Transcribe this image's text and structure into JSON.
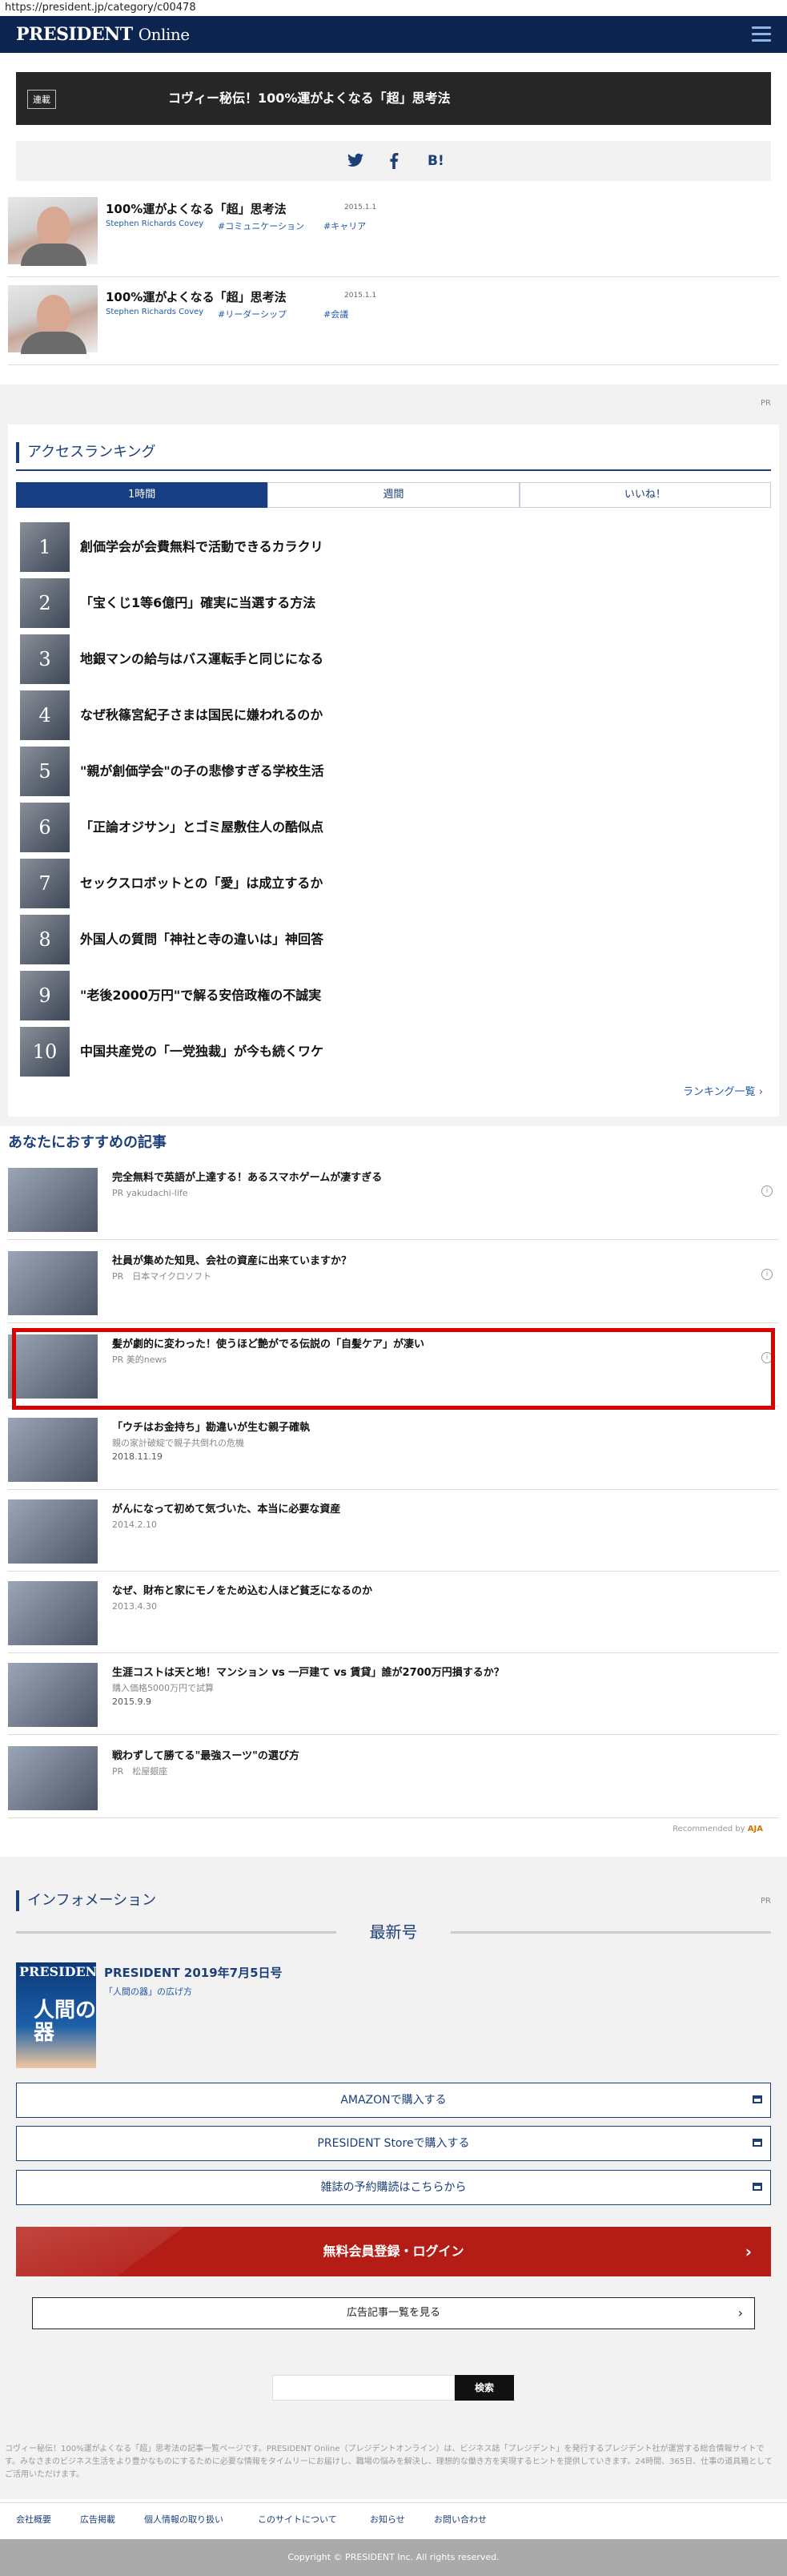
{
  "browser": {
    "url": "https://president.jp/category/c00478"
  },
  "header": {
    "logo_main": "PRESIDENT",
    "logo_sub": "Online",
    "menu_icon": "hamburger-menu-icon"
  },
  "banner": {
    "tag": "連載",
    "title": "コヴィー秘伝！100%運がよくなる「超」思考法"
  },
  "share": {
    "twitter": "twitter-icon",
    "facebook": "facebook-icon",
    "hatena": "B!"
  },
  "authors": [
    {
      "title": "100%運がよくなる「超」思考法",
      "date": "2015.1.1",
      "author": "Stephen Richards Covey",
      "tags": [
        "#コミュニケーション",
        "#キャリア"
      ]
    },
    {
      "title": "100%運がよくなる「超」思考法",
      "date": "2015.1.1",
      "author": "Stephen Richards Covey",
      "tags": [
        "#リーダーシップ",
        "#会議"
      ]
    }
  ],
  "pr_label": "PR",
  "ranking": {
    "heading": "アクセスランキング",
    "tabs": [
      "1時間",
      "週間",
      "いいね！"
    ],
    "active_tab": "1時間",
    "items": [
      {
        "rank": "1",
        "title": "創価学会が会費無料で活動できるカラクリ"
      },
      {
        "rank": "2",
        "title": "「宝くじ1等6億円」確実に当選する方法"
      },
      {
        "rank": "3",
        "title": "地銀マンの給与はバス運転手と同じになる"
      },
      {
        "rank": "4",
        "title": "なぜ秋篠宮紀子さまは国民に嫌われるのか"
      },
      {
        "rank": "5",
        "title": "\"親が創価学会\"の子の悲惨すぎる学校生活"
      },
      {
        "rank": "6",
        "title": "「正論オジサン」とゴミ屋敷住人の酷似点"
      },
      {
        "rank": "7",
        "title": "セックスロボットとの「愛」は成立するか"
      },
      {
        "rank": "8",
        "title": "外国人の質問「神社と寺の違いは」神回答"
      },
      {
        "rank": "9",
        "title": "\"老後2000万円\"で解る安倍政権の不誠実"
      },
      {
        "rank": "10",
        "title": "中国共産党の「一党独裁」が今も続くワケ"
      }
    ],
    "more": "ランキング一覧"
  },
  "recommend": {
    "heading": "あなたにおすすめの記事",
    "items": [
      {
        "title": "完全無料で英語が上達する！あるスマホゲームが凄すぎる",
        "sub": "PR yakudachi-life",
        "date": "",
        "info": "i"
      },
      {
        "title": "社員が集めた知見、会社の資産に出来ていますか？",
        "sub": "PR　日本マイクロソフト",
        "date": "",
        "info": "i"
      },
      {
        "title": "髪が劇的に変わった！使うほど艶がでる伝説の「自髪ケア」が凄い",
        "sub": "PR 美的news",
        "date": "",
        "info": "i"
      },
      {
        "title": "「ウチはお金持ち」勘違いが生む親子確執",
        "sub": "親の家計破綻で親子共倒れの危機",
        "date": "2018.11.19",
        "info": ""
      },
      {
        "title": "がんになって初めて気づいた、本当に必要な資産",
        "sub": "",
        "date": "2014.2.10",
        "info": ""
      },
      {
        "title": "なぜ、財布と家にモノをため込む人ほど貧乏になるのか",
        "sub": "",
        "date": "2013.4.30",
        "info": ""
      },
      {
        "title": "生涯コストは天と地！マンション vs 一戸建て vs 賃貸」誰が2700万円損するか？",
        "sub": "購入価格5000万円で試算",
        "date": "2015.9.9",
        "info": ""
      },
      {
        "title": "戦わずして勝てる\"最強スーツ\"の選び方",
        "sub": "PR　松屋銀座",
        "date": "",
        "info": ""
      }
    ],
    "recommended_by": "Recommended by",
    "recommended_brand": "AJA"
  },
  "information": {
    "heading": "インフォメーション",
    "newest": "最新号",
    "cover_logo": "PRESIDENT",
    "cover_text": "人間の器",
    "magazine_title": "PRESIDENT 2019年7月5日号",
    "magazine_sub": "「人間の器」の広げ方",
    "buttons": [
      "AMAZONで購入する",
      "PRESIDENT Storeで購入する",
      "雑誌の予約購読はこちらから"
    ],
    "login": "無料会員登録・ログイン",
    "ad_list": "広告記事一覧を見る"
  },
  "search": {
    "placeholder": "",
    "button": "検索"
  },
  "footer": {
    "description": "コヴィー秘伝！100%運がよくなる「超」思考法の記事一覧ページです。PRESIDENT Online（プレジデントオンライン）は、ビジネス誌「プレジデント」を発行するプレジデント社が運営する総合情報サイトです。みなさまのビジネス生活をより豊かなものにするために必要な情報をタイムリーにお届けし、職場の悩みを解決し、理想的な働き方を実現するヒントを提供していきます。24時間、365日、仕事の道具箱としてご活用いただけます。",
    "links": [
      "会社概要",
      "広告掲載",
      "個人情報の取り扱い",
      "このサイトについて",
      "お知らせ",
      "お問い合わせ"
    ],
    "copyright": "Copyright © PRESIDENT Inc. All rights reserved."
  }
}
